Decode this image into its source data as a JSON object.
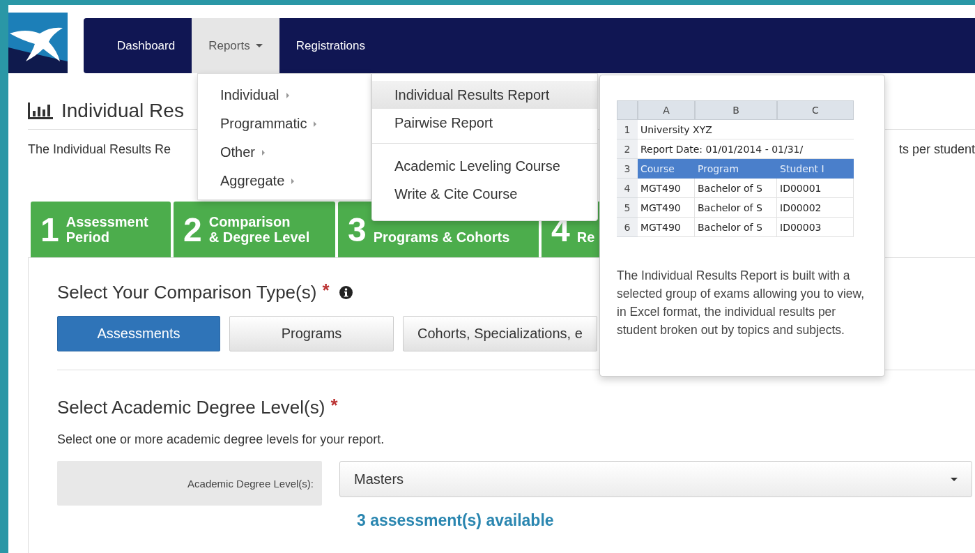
{
  "nav": {
    "items": [
      {
        "label": "Dashboard",
        "selected": false,
        "dropdown": false
      },
      {
        "label": "Reports",
        "selected": true,
        "dropdown": true
      },
      {
        "label": "Registrations",
        "selected": false,
        "dropdown": false
      }
    ]
  },
  "page": {
    "title": "Individual Res",
    "description": "The Individual Results Re",
    "description_tail": "ts per student"
  },
  "steps": [
    {
      "number": "1",
      "label_lines": [
        "Assessment",
        "Period"
      ]
    },
    {
      "number": "2",
      "label_lines": [
        "Comparison",
        "& Degree Level"
      ]
    },
    {
      "number": "3",
      "label_lines": [
        "Programs & Cohorts"
      ]
    },
    {
      "number": "4",
      "label_lines": [
        "Re"
      ]
    }
  ],
  "comparison": {
    "title": "Select Your Comparison Type(s)",
    "required_mark": "*",
    "info": true,
    "options": [
      {
        "label": "Assessments",
        "selected": true
      },
      {
        "label": "Programs",
        "selected": false
      },
      {
        "label": "Cohorts, Specializations, e",
        "selected": false
      }
    ]
  },
  "degree": {
    "title": "Select Academic Degree Level(s)",
    "required_mark": "*",
    "help": "Select one or more academic degree levels for your report.",
    "field_label": "Academic Degree Level(s):",
    "value": "Masters",
    "available": "3 assessment(s) available"
  },
  "reports_menu": {
    "items": [
      {
        "label": "Individual",
        "has_submenu": true,
        "selected": false
      },
      {
        "label": "Programmatic",
        "has_submenu": true,
        "selected": false
      },
      {
        "label": "Other",
        "has_submenu": true,
        "selected": false
      },
      {
        "label": "Aggregate",
        "has_submenu": true,
        "selected": false
      }
    ]
  },
  "submenu": {
    "sections": [
      {
        "items": [
          {
            "label": "Individual Results Report",
            "selected": true
          },
          {
            "label": "Pairwise Report",
            "selected": false
          }
        ]
      },
      {
        "items": [
          {
            "label": "Academic Leveling Course",
            "selected": false
          },
          {
            "label": "Write & Cite Course",
            "selected": false
          }
        ]
      }
    ]
  },
  "tooltip": {
    "sheet": {
      "columns": [
        "A",
        "B",
        "C"
      ],
      "rows": [
        {
          "number": "1",
          "kind": "span",
          "cells": [
            "University XYZ"
          ]
        },
        {
          "number": "2",
          "kind": "span",
          "cells": [
            "Report Date: 01/01/2014 - 01/31/"
          ]
        },
        {
          "number": "3",
          "kind": "header",
          "cells": [
            "Course",
            "Program",
            "Student I"
          ]
        },
        {
          "number": "4",
          "kind": "data",
          "cells": [
            "MGT490",
            "Bachelor of S",
            "ID00001"
          ]
        },
        {
          "number": "5",
          "kind": "data",
          "cells": [
            "MGT490",
            "Bachelor of S",
            "ID00002"
          ]
        },
        {
          "number": "6",
          "kind": "data",
          "cells": [
            "MGT490",
            "Bachelor of S",
            "ID00003"
          ]
        }
      ]
    },
    "text": "The Individual Results Report is built with a selected group of exams allowing you to view, in Excel format, the individual results per student broken out by topics and subjects."
  }
}
